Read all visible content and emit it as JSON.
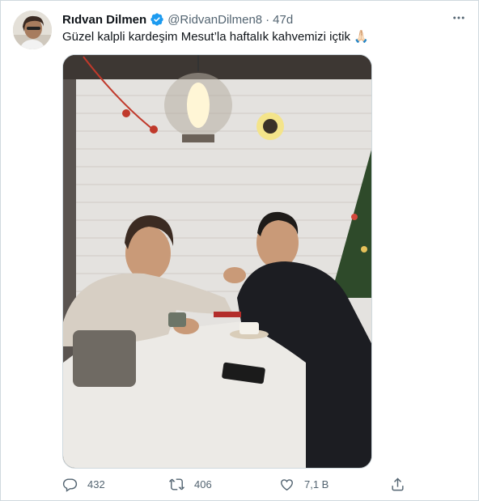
{
  "tweet": {
    "author_name": "Rıdvan Dilmen",
    "handle": "@RidvanDilmen8",
    "separator": "·",
    "time": "47d",
    "text": "Güzel kalpli kardeşim Mesut’la haftalık kahvemizi içtik 🙏🏻"
  },
  "metrics": {
    "replies": "432",
    "retweets": "406",
    "likes": "7,1 B"
  },
  "icons": {
    "verified": "verified-badge-icon",
    "more": "more-options-icon",
    "reply": "reply-icon",
    "retweet": "retweet-icon",
    "like": "heart-icon",
    "share": "share-icon"
  },
  "colors": {
    "text": "#0f1419",
    "secondary": "#536471",
    "verified_blue": "#1d9bf0",
    "border": "#cfd9de"
  }
}
